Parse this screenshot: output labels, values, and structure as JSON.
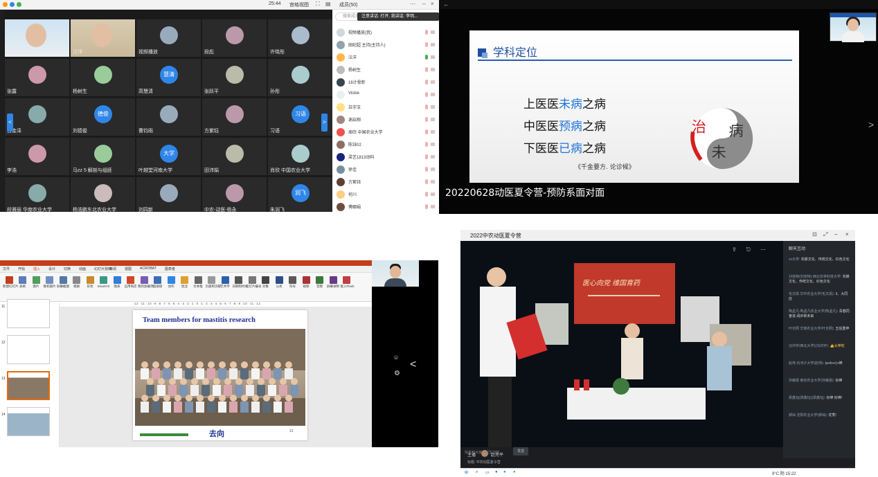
{
  "panel_a": {
    "time": "25:44",
    "view_label": "宫格视图",
    "members_title": "成员(50)",
    "search_placeholder": "搜索成员",
    "toast": "注意讲话: 打开, 我讲话: 李明...",
    "grid_left": "<",
    "grid_right": ">",
    "tiles": [
      {
        "name": "田纪超-主持",
        "kind": "photo1"
      },
      {
        "name": "汪洋",
        "kind": "photo2"
      },
      {
        "name": "视频播放",
        "kind": "av"
      },
      {
        "name": "段彪",
        "kind": "av"
      },
      {
        "name": "许晓彤",
        "kind": "av"
      },
      {
        "name": "张露",
        "kind": "av"
      },
      {
        "name": "杨树生",
        "kind": "av"
      },
      {
        "name": "高慧清",
        "kind": "text",
        "avatar_text": "慧清"
      },
      {
        "name": "张跃平",
        "kind": "av"
      },
      {
        "name": "孙彤",
        "kind": "av"
      },
      {
        "name": "吕金泽",
        "kind": "av"
      },
      {
        "name": "刘德俊",
        "kind": "text",
        "avatar_text": "德俊"
      },
      {
        "name": "曹钧雨",
        "kind": "av"
      },
      {
        "name": "方紫钰",
        "kind": "av"
      },
      {
        "name": "习语",
        "kind": "text",
        "avatar_text": "习语"
      },
      {
        "name": "李浩",
        "kind": "av"
      },
      {
        "name": "马zz 5 解剖与组胚",
        "kind": "av"
      },
      {
        "name": "叶越堂河南大学",
        "kind": "text",
        "avatar_text": "大学"
      },
      {
        "name": "田沛娟",
        "kind": "av"
      },
      {
        "name": "肖欣 中国农业大学",
        "kind": "av"
      },
      {
        "name": "段雅丽 华南农业大学",
        "kind": "av"
      },
      {
        "name": "杨浩鹏东北农业大学",
        "kind": "av"
      },
      {
        "name": "刘四新",
        "kind": "av"
      },
      {
        "name": "中农-动医-杨永",
        "kind": "av"
      },
      {
        "name": "朱润飞",
        "kind": "text",
        "avatar_text": "润飞"
      }
    ],
    "members": [
      {
        "name": "视频播放(我)"
      },
      {
        "name": "田纪超 主持(主持人)"
      },
      {
        "name": "汪洋"
      },
      {
        "name": "杨树生"
      },
      {
        "name": "16计骨彰"
      },
      {
        "name": "Vickie"
      },
      {
        "name": "吕宇玉"
      },
      {
        "name": "谢启翔"
      },
      {
        "name": "周欣 中国农业大学"
      },
      {
        "name": "陈钰02"
      },
      {
        "name": "梁艺1813动科"
      },
      {
        "name": "徐佳"
      },
      {
        "name": "方紫钰"
      },
      {
        "name": "何川"
      },
      {
        "name": "傅娜娟"
      }
    ]
  },
  "panel_b": {
    "slide_title": "学科定位",
    "line1_a": "上医医",
    "line1_hl": "未病",
    "line1_b": "之病",
    "line2_a": "中医医",
    "line2_hl": "预病",
    "line2_b": "之病",
    "line3_a": "下医医",
    "line3_hl": "已病",
    "line3_b": "之病",
    "quote": "《千金要方. 论诊候》",
    "logo_chars": [
      "治",
      "未",
      "病"
    ],
    "caption": "20220628动医夏令营-预防系面对面",
    "pip_banner": "2022夏令营",
    "back": "←",
    "next": ">"
  },
  "panel_c": {
    "tabs": [
      "文件",
      "开始",
      "插入",
      "设计",
      "切换",
      "动画",
      "幻灯片放映",
      "审阅",
      "视图",
      "ACROBAT",
      "图表者"
    ],
    "ribbon_buttons": [
      "新建幻灯片",
      "表格",
      "图片",
      "联机图片",
      "屏幕截图",
      "相册",
      "形状",
      "SmartArt",
      "图表",
      "应用商店",
      "我的加载项",
      "超链接",
      "动作",
      "批注",
      "文本框",
      "页眉和页脚",
      "艺术字",
      "日期和时间",
      "幻灯片编号",
      "对象",
      "公式",
      "符号",
      "视频",
      "音频",
      "屏幕录制",
      "嵌入Flash"
    ],
    "ruler": "·12 ·11 ·10 ·9 ·8 ·7 ·6 ·5 ·4 ·3 ·2 ·1 ·0 ·1 ·2 ·3 ·4 ·5 ·6 ·7 ·8 ·9 ·10 ·11 ·12",
    "thumb_numbers": [
      "11",
      "12",
      "13",
      "14"
    ],
    "slide_title": "Team members for mastitis research",
    "slide_footer": "去向",
    "slide_number": "12",
    "camera_icon": "⌾",
    "settings_icon": "⚙",
    "chev": "<"
  },
  "panel_d": {
    "title": "2022中农动医夏令营",
    "backdrop_title": "医心向党 维国育药",
    "chat_title": "聊天互动",
    "messages": [
      {
        "user": "xx大学:",
        "text": "农耕文化、传统文化、红色文化",
        "hl": false
      },
      {
        "user": "刘佳特(刘佳特)-西北农林科技大学:",
        "text": "农耕文化、传统文化、红色文化",
        "hl": false
      },
      {
        "user": "毛文倩 华中农业大学(毛文倩):",
        "text": "3、大同店",
        "hl": false
      },
      {
        "user": "陶孟凡-陶孟凡农业大学(陶孟凡):",
        "text": "青春同奋进 阔步新未来",
        "hl": false
      },
      {
        "user": "叶长照 华南农业大学(叶长照):",
        "text": "五信重申",
        "hl": false
      },
      {
        "user": "冯鸿宇(西北大学)(冯鸿宇):",
        "text": "👍太棒啦",
        "hl": true
      },
      {
        "user": "赵伟 石河子大学(赵伟):",
        "text": "(a+b+c)+棒",
        "hl": false
      },
      {
        "user": "孙静雯 南京农业大学(孙静雯):",
        "text": "好棒",
        "hl": false
      },
      {
        "user": "梁鑫钰(梁鑫钰)(梁鑫钰):",
        "text": "好棒 好棒!",
        "hl": false
      },
      {
        "user": "郝灿 沈阳农业大学(郝灿):",
        "text": "优秀!",
        "hl": false
      }
    ],
    "chat_input": "快来和大家一起互动吧",
    "send": "发送",
    "host_label": "主播",
    "host_name": "赵亮平",
    "host_topic": "标题: 中农动医夏令营",
    "taskbar_weather": "9°C 阴",
    "taskbar_time": "15:22"
  }
}
